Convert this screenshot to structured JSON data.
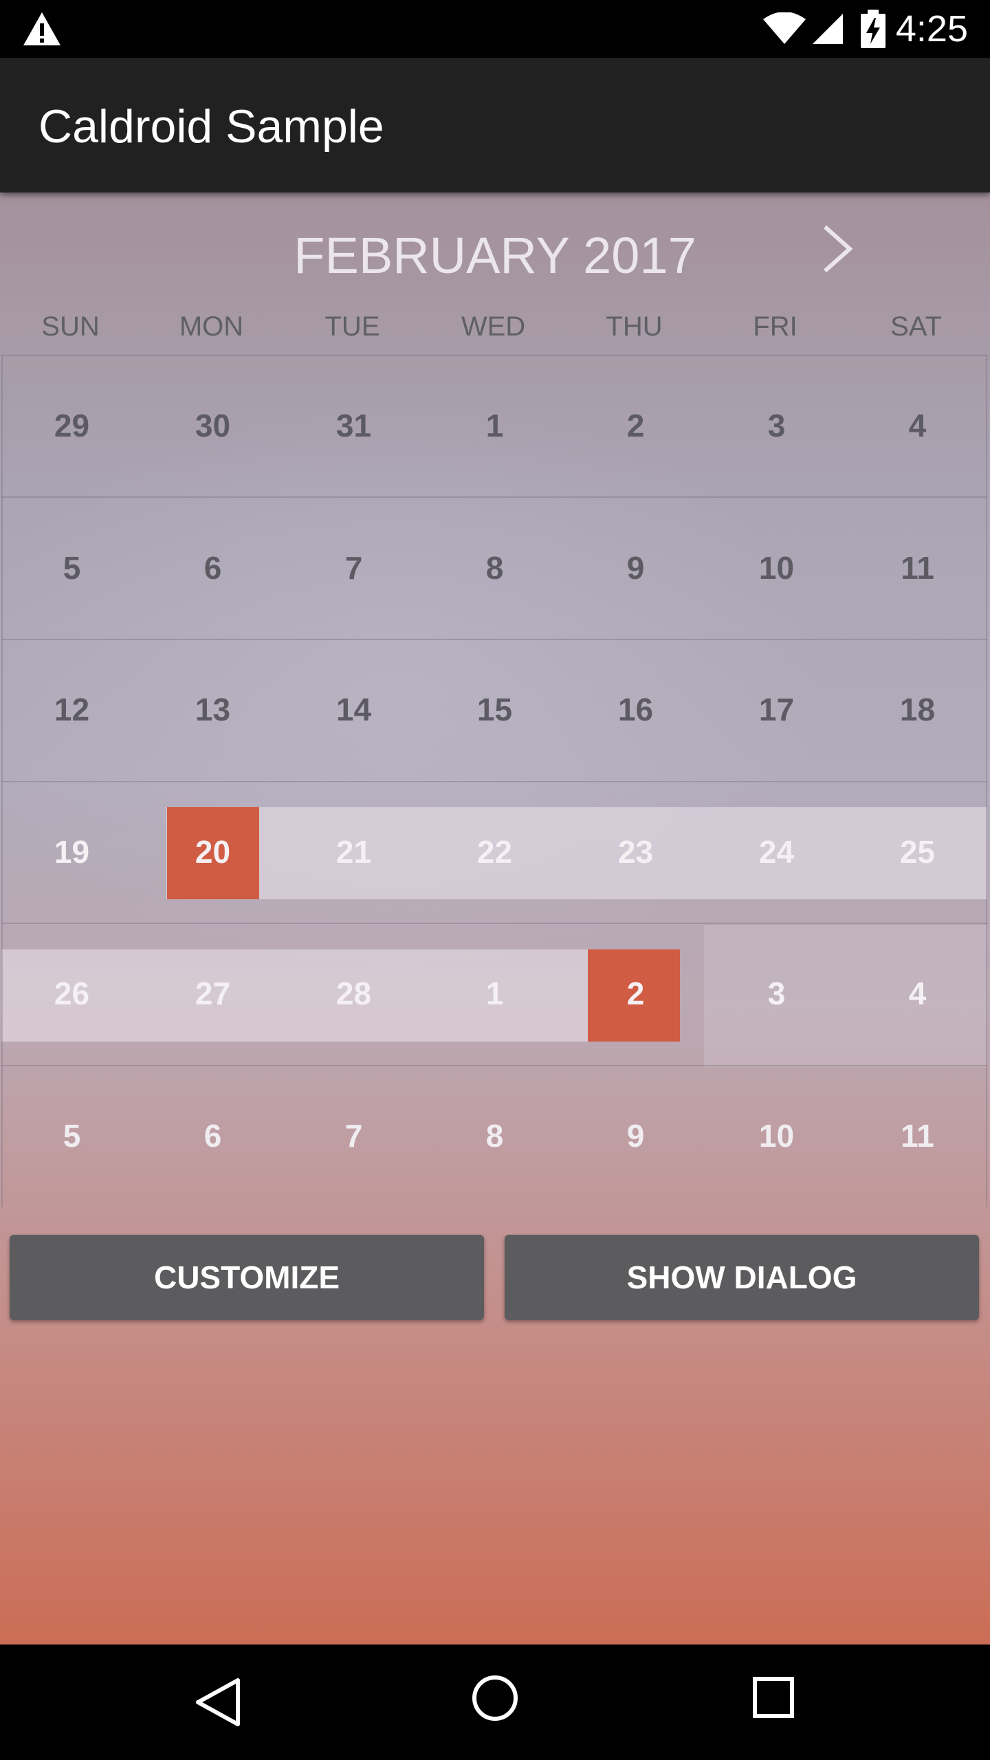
{
  "status_bar": {
    "time": "4:25",
    "icons": [
      "warning-icon",
      "wifi-icon",
      "signal-icon",
      "battery-charging-icon"
    ]
  },
  "app_bar": {
    "title": "Caldroid Sample"
  },
  "calendar": {
    "month_title": "FEBRUARY 2017",
    "next_icon": "chevron-right-icon",
    "weekdays": [
      "SUN",
      "MON",
      "TUE",
      "WED",
      "THU",
      "FRI",
      "SAT"
    ],
    "weeks": [
      [
        "29",
        "30",
        "31",
        "1",
        "2",
        "3",
        "4"
      ],
      [
        "5",
        "6",
        "7",
        "8",
        "9",
        "10",
        "11"
      ],
      [
        "12",
        "13",
        "14",
        "15",
        "16",
        "17",
        "18"
      ],
      [
        "19",
        "20",
        "21",
        "22",
        "23",
        "24",
        "25"
      ],
      [
        "26",
        "27",
        "28",
        "1",
        "2",
        "3",
        "4"
      ],
      [
        "5",
        "6",
        "7",
        "8",
        "9",
        "10",
        "11"
      ]
    ],
    "selected_dates": [
      "20",
      "2"
    ],
    "colors": {
      "selected": "#d05c44",
      "day_text": "#5c5b63"
    }
  },
  "buttons": {
    "customize": "CUSTOMIZE",
    "show_dialog": "SHOW DIALOG"
  },
  "nav_bar": {
    "icons": [
      "back-icon",
      "home-icon",
      "recents-icon"
    ]
  }
}
